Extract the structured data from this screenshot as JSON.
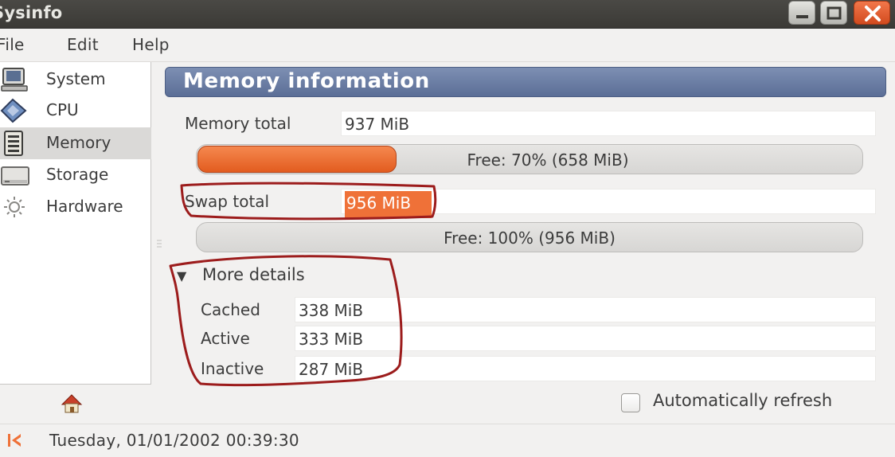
{
  "window": {
    "title": "Sysinfo"
  },
  "menu": {
    "items": [
      "File",
      "Edit",
      "Help"
    ]
  },
  "sidebar": {
    "items": [
      {
        "label": "System",
        "icon": "computer-icon",
        "selected": false
      },
      {
        "label": "CPU",
        "icon": "cpu-chip-icon",
        "selected": false
      },
      {
        "label": "Memory",
        "icon": "memory-module-icon",
        "selected": true
      },
      {
        "label": "Storage",
        "icon": "hard-drive-icon",
        "selected": false
      },
      {
        "label": "Hardware",
        "icon": "gear-icon",
        "selected": false
      }
    ]
  },
  "memory": {
    "header": "Memory information",
    "total_label": "Memory total",
    "total_value": "937 MiB",
    "free_text": "Free: 70% (658 MiB)",
    "used_fraction": 0.3,
    "swap_label": "Swap total",
    "swap_value": "956 MiB",
    "swap_free_text": "Free: 100% (956 MiB)",
    "swap_used_fraction": 0.0,
    "details_label": "More details",
    "details": [
      {
        "label": "Cached",
        "value": "338 MiB"
      },
      {
        "label": "Active",
        "value": "333 MiB"
      },
      {
        "label": "Inactive",
        "value": "287 MiB"
      }
    ]
  },
  "refresh": {
    "label": "Automatically refresh",
    "checked": false
  },
  "status": {
    "datetime": "Tuesday, 01/01/2002 00:39:30"
  },
  "colors": {
    "accent": "#ef7138",
    "header": "#6b7ea4",
    "annotation": "#9c1c1c"
  }
}
